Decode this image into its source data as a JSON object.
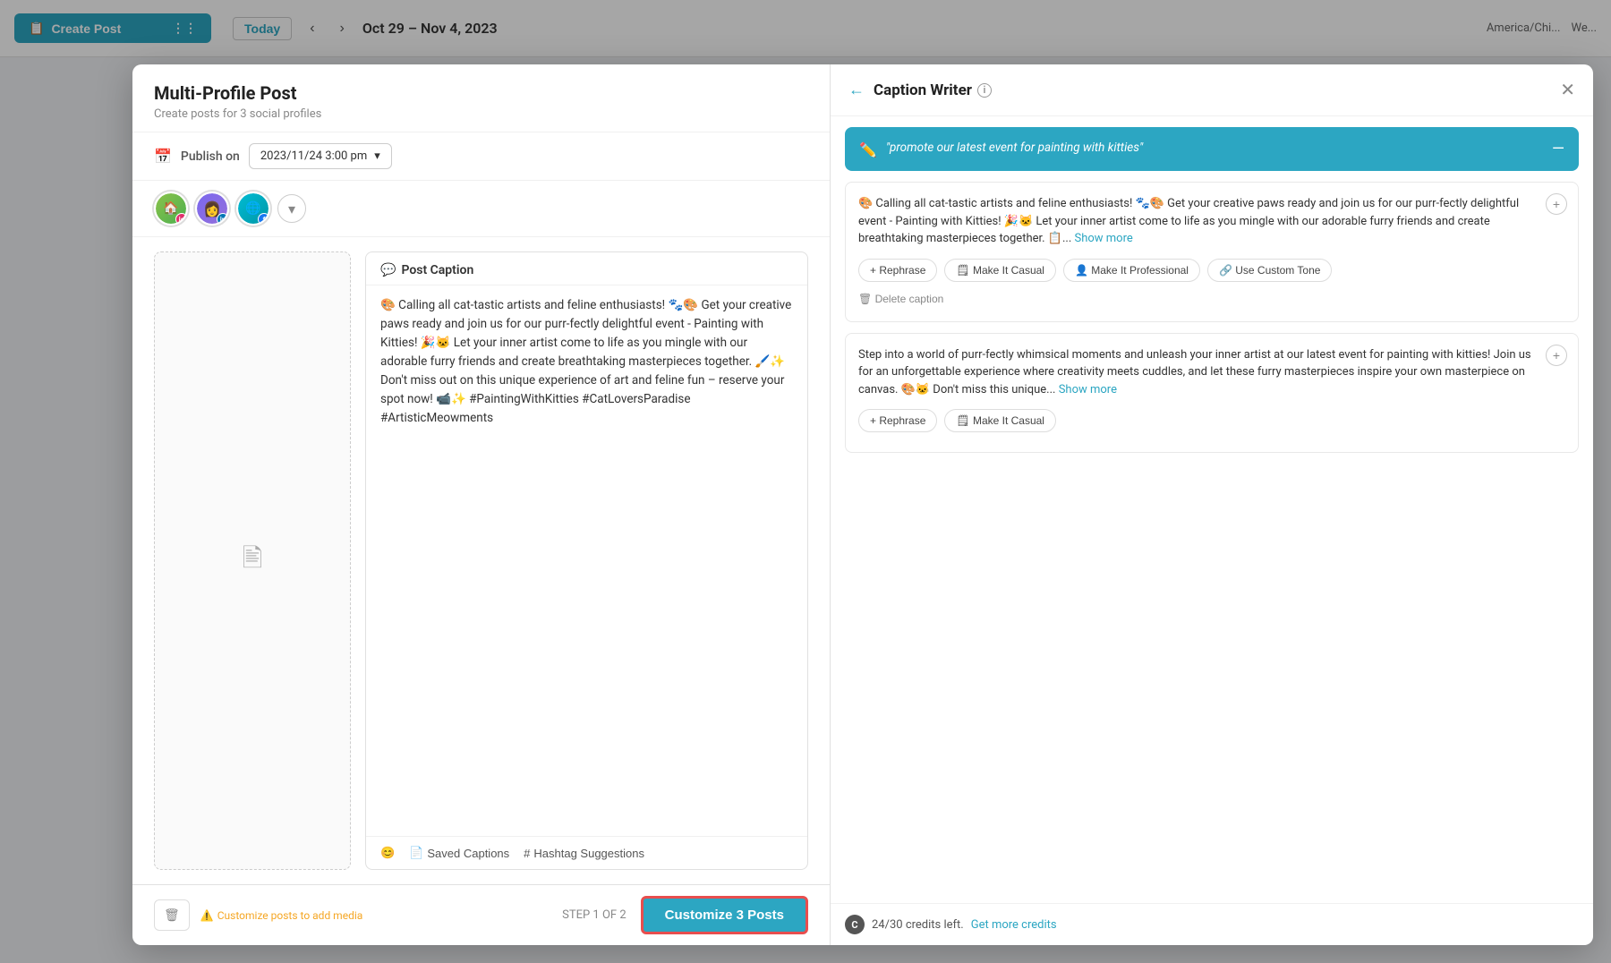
{
  "topbar": {
    "create_post_label": "Create Post",
    "today_label": "Today",
    "date_range": "Oct 29 – Nov 4, 2023",
    "timezone": "America/Chi...",
    "week_label": "We..."
  },
  "modal": {
    "title": "Multi-Profile Post",
    "subtitle": "Create posts for 3 social profiles",
    "publish_label": "Publish on",
    "publish_date": "2023/11/24 3:00 pm",
    "step_indicator": "STEP 1 OF 2",
    "customize_btn": "Customize 3 Posts",
    "media_warning": "Customize posts to add media",
    "caption_header": "Post Caption",
    "caption_text": "🎨 Calling all cat-tastic artists and feline enthusiasts! 🐾🎨 Get your creative paws ready and join us for our purr-fectly delightful event - Painting with Kitties! 🎉🐱 Let your inner artist come to life as you mingle with our adorable furry friends and create breathtaking masterpieces together. 🖌️✨ Don't miss out on this unique experience of art and feline fun – reserve your spot now! 📹✨ #PaintingWithKitties #CatLoversParadise #ArtisticMeowments",
    "saved_captions_label": "Saved Captions",
    "hashtag_suggestions_label": "Hashtag Suggestions"
  },
  "caption_writer": {
    "title": "Caption Writer",
    "prompt": "\"promote our latest event for painting with kitties\"",
    "caption1": {
      "text": "🎨 Calling all cat-tastic artists and feline enthusiasts! 🐾🎨 Get your creative paws ready and join us for our purr-fectly delightful event - Painting with Kitties! 🎉🐱 Let your inner artist come to life as you mingle with our adorable furry friends and create breathtaking masterpieces together. 📋...",
      "show_more": "Show more",
      "rephrase_label": "+ Rephrase",
      "make_casual_label": "🗒 Make It Casual",
      "make_professional_label": "👤 Make It Professional",
      "use_custom_tone_label": "🔗 Use Custom Tone",
      "delete_caption_label": "🗑 Delete caption"
    },
    "caption2": {
      "text": "Step into a world of purr-fectly whimsical moments and unleash your inner artist at our latest event for painting with kitties! Join us for an unforgettable experience where creativity meets cuddles, and let these furry masterpieces inspire your own masterpiece on canvas. 🎨🐱 Don't miss this unique...",
      "show_more": "Show more",
      "rephrase_label": "+ Rephrase",
      "make_casual_label": "🗒 Make It Casual"
    },
    "credits": "24/30 credits left.",
    "get_more_credits": "Get more credits"
  }
}
